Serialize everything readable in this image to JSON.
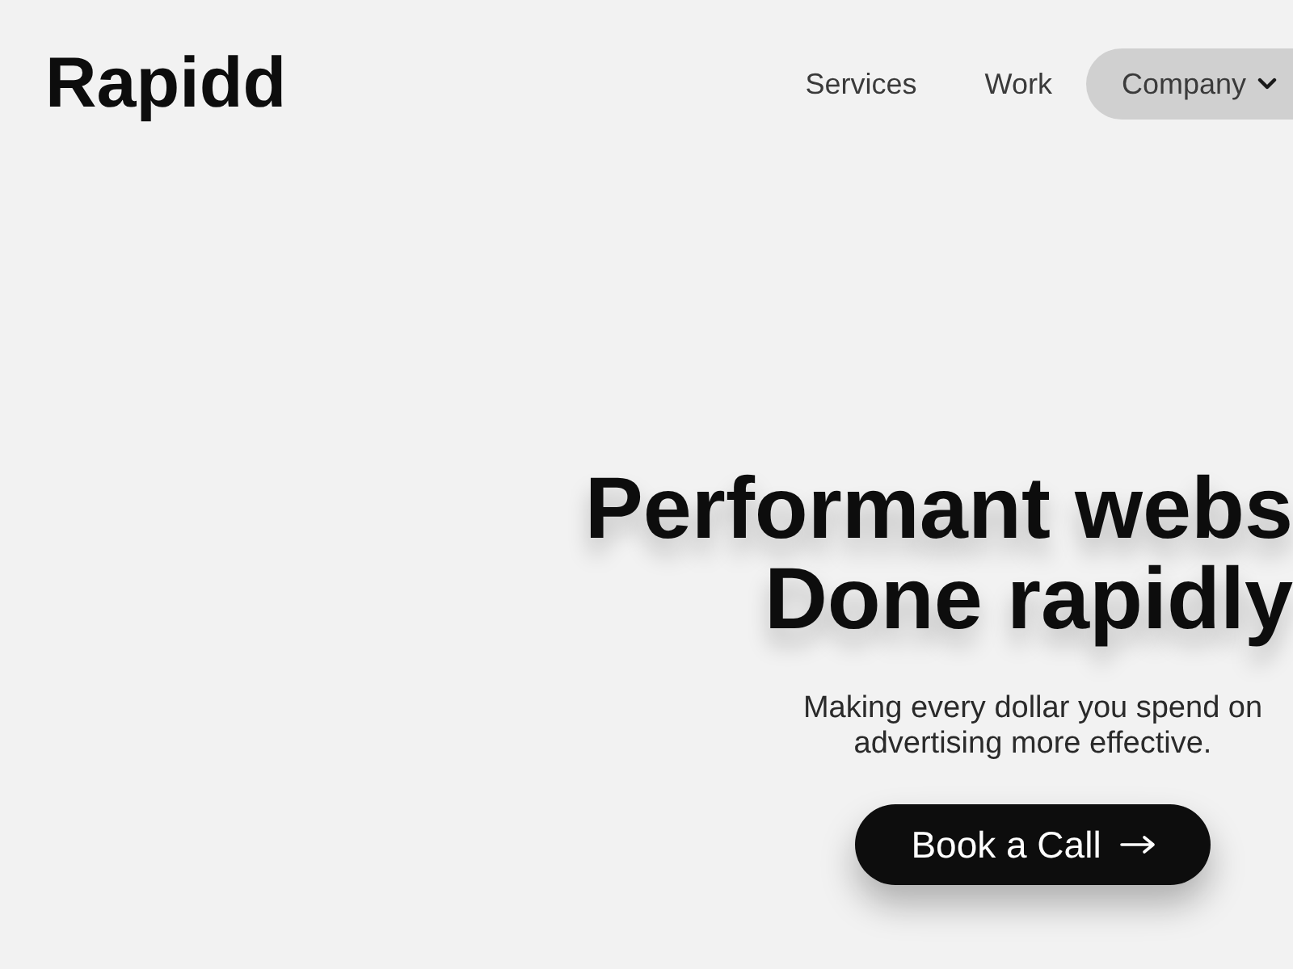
{
  "brand": {
    "name": "Rapidd"
  },
  "nav": {
    "items": [
      {
        "label": "Services",
        "kind": "link",
        "selected": false
      },
      {
        "label": "Work",
        "kind": "link",
        "selected": false
      },
      {
        "label": "Company",
        "kind": "dropdown",
        "selected": true
      }
    ]
  },
  "hero": {
    "heading_lines": [
      "Performant webs",
      "Done rapidly"
    ],
    "subtitle": "Making every dollar you spend on advertising more effective.",
    "cta": {
      "label": "Book a Call"
    }
  }
}
